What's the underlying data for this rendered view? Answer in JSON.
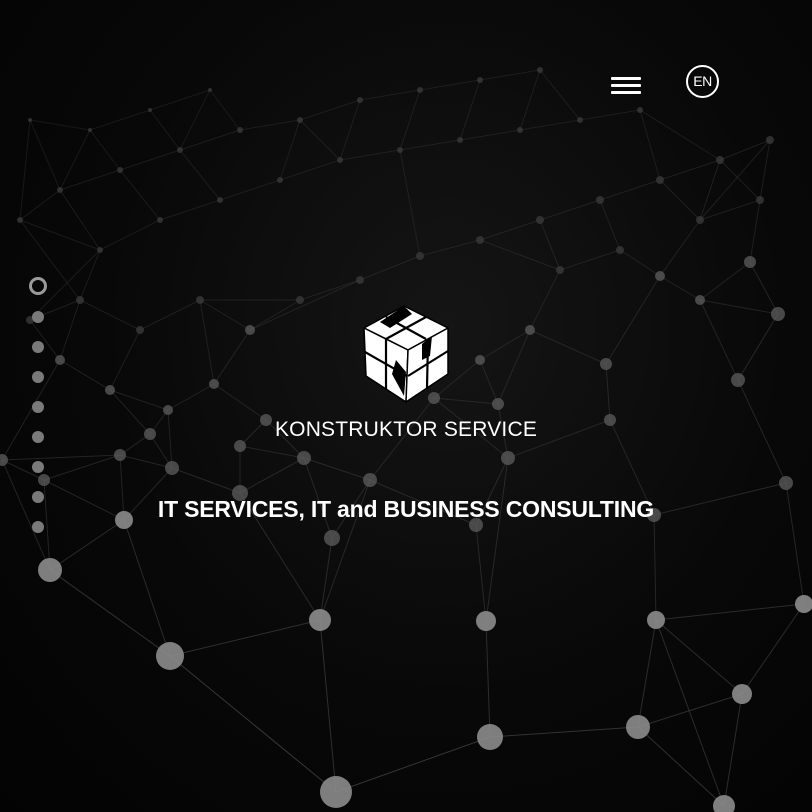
{
  "header": {
    "menu_icon": "hamburger-menu-icon",
    "language": "EN"
  },
  "hero": {
    "logo_icon": "cube-logo-icon",
    "brand_name": "KONSTRUKTOR SERVICE",
    "tagline": "IT SERVICES, IT and BUSINESS CONSULTING"
  },
  "slider": {
    "dot_count": 9,
    "active_index": 0
  },
  "colors": {
    "background": "#050505",
    "foreground": "#ffffff",
    "network_line": "#3a3a3a",
    "network_node": "#8a8a8a"
  }
}
